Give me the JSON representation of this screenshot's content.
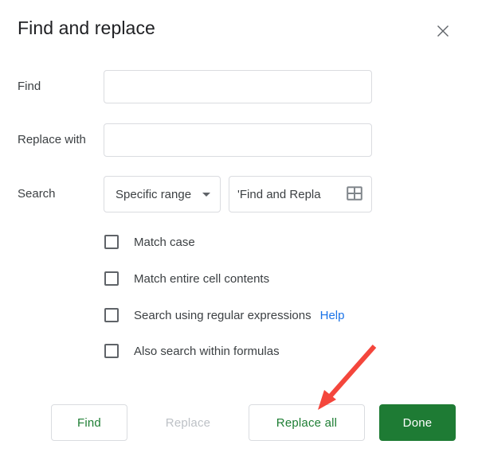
{
  "dialog": {
    "title": "Find and replace",
    "close_icon": "close-icon"
  },
  "fields": {
    "find": {
      "label": "Find",
      "value": "",
      "placeholder": ""
    },
    "replace_with": {
      "label": "Replace with",
      "value": "",
      "placeholder": ""
    },
    "search": {
      "label": "Search",
      "scope_selected": "Specific range",
      "scope_caret_icon": "chevron-down-icon",
      "range_value": "'Find and Repla",
      "range_picker_icon": "grid-select-icon"
    }
  },
  "options": [
    {
      "label": "Match case",
      "checked": false
    },
    {
      "label": "Match entire cell contents",
      "checked": false
    },
    {
      "label": "Search using regular expressions",
      "checked": false,
      "help_label": "Help"
    },
    {
      "label": "Also search within formulas",
      "checked": false
    }
  ],
  "buttons": {
    "find": "Find",
    "replace": "Replace",
    "replace_all": "Replace all",
    "done": "Done"
  },
  "colors": {
    "green_primary": "#1e7b34",
    "green_text": "#1e7e34",
    "link_blue": "#1a73e8",
    "border_gray": "#dadce0",
    "text_primary": "#202124",
    "text_secondary": "#3c4043",
    "text_disabled": "#bdc1c6",
    "annotation_red": "#f4463c"
  }
}
